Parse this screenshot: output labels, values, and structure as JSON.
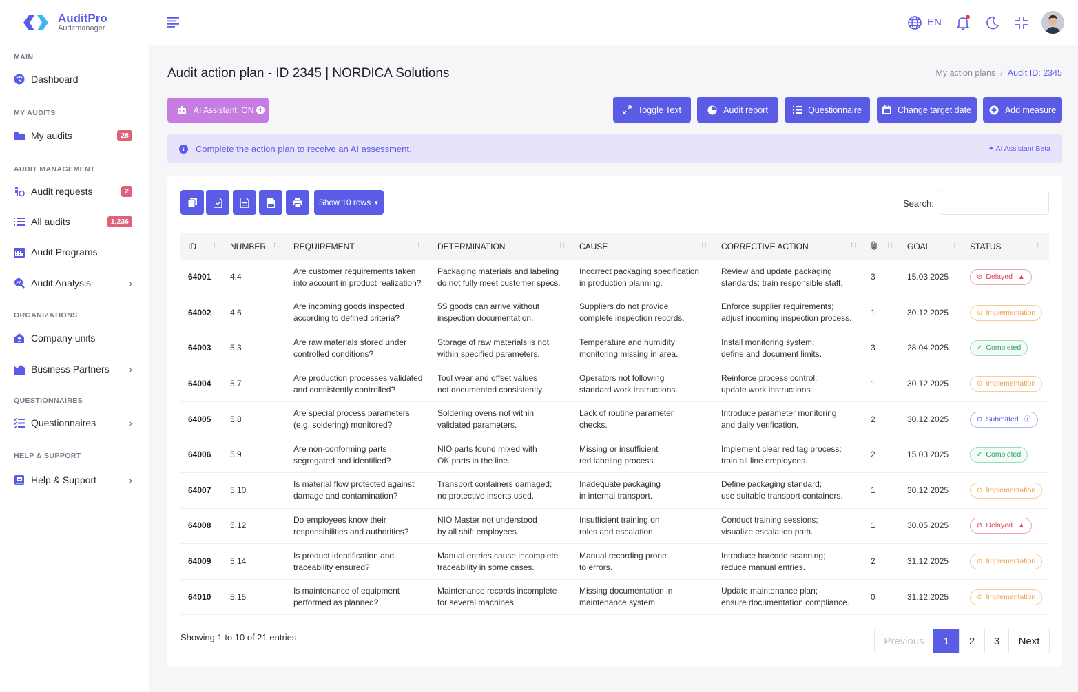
{
  "app": {
    "name": "AuditPro",
    "subtitle": "Auditmanager",
    "brand_color": "#5b5ce6"
  },
  "sidebar": {
    "sections": [
      {
        "title": "MAIN"
      },
      {
        "title": "MY AUDITS"
      },
      {
        "title": "AUDIT MANAGEMENT"
      },
      {
        "title": "ORGANIZATIONS"
      },
      {
        "title": "QUESTIONNAIRES"
      },
      {
        "title": "HELP & SUPPORT"
      }
    ],
    "items": [
      {
        "label": "Dashboard",
        "icon": "dashboard-icon"
      },
      {
        "label": "My audits",
        "icon": "folder-icon",
        "badge": "28"
      },
      {
        "label": "Audit requests",
        "icon": "request-icon",
        "badge": "2"
      },
      {
        "label": "All audits",
        "icon": "list-icon",
        "badge": "1,236"
      },
      {
        "label": "Audit Programs",
        "icon": "calendar-icon"
      },
      {
        "label": "Audit Analysis",
        "icon": "analysis-icon",
        "chevron": true
      },
      {
        "label": "Company units",
        "icon": "company-icon"
      },
      {
        "label": "Business Partners",
        "icon": "chart-icon",
        "chevron": true
      },
      {
        "label": "Questionnaires",
        "icon": "checklist-icon",
        "chevron": true
      },
      {
        "label": "Help & Support",
        "icon": "help-icon",
        "chevron": true
      }
    ]
  },
  "topbar": {
    "language": "EN"
  },
  "page": {
    "title": "Audit action plan - ID 2345 | NORDICA Solutions",
    "breadcrumb": [
      "My action plans",
      "Audit ID: 2345"
    ]
  },
  "toolbar": {
    "ai_assistant": "AI Assistant: ON",
    "buttons": [
      "Toggle Text",
      "Audit report",
      "Questionnaire",
      "Change target date",
      "Add measure"
    ]
  },
  "alert": {
    "text": "Complete the action plan to receive an AI assessment.",
    "right": "AI Assistant Beta"
  },
  "table": {
    "show_rows": "Show 10 rows",
    "search_label": "Search:",
    "columns": [
      "ID",
      "NUMBER",
      "REQUIREMENT",
      "DETERMINATION",
      "CAUSE",
      "CORRECTIVE ACTION",
      "",
      "GOAL",
      "STATUS"
    ],
    "rows": [
      {
        "id": "64001",
        "number": "4.4",
        "req1": "Are customer requirements taken",
        "req2": "into account in product realization?",
        "det1": "Packaging materials and labeling",
        "det2": "do not fully meet customer specs.",
        "cause1": "Incorrect packaging specification",
        "cause2": "in production planning.",
        "act1": "Review and update packaging",
        "act2": "standards; train responsible staff.",
        "att": "3",
        "goal": "15.03.2025",
        "status": "Delayed",
        "kind": "delayed"
      },
      {
        "id": "64002",
        "number": "4.6",
        "req1": "Are incoming goods inspected",
        "req2": "according to defined criteria?",
        "det1": "5S goods can arrive without",
        "det2": "inspection documentation.",
        "cause1": "Suppliers do not provide",
        "cause2": "complete inspection records.",
        "act1": "Enforce supplier requirements;",
        "act2": "adjust incoming inspection process.",
        "att": "1",
        "goal": "30.12.2025",
        "status": "Implementation",
        "kind": "impl"
      },
      {
        "id": "64003",
        "number": "5.3",
        "req1": "Are raw materials stored under",
        "req2": "controlled conditions?",
        "det1": "Storage of raw materials is not",
        "det2": "within specified parameters.",
        "cause1": "Temperature and humidity",
        "cause2": "monitoring missing in area.",
        "act1": "Install monitoring system;",
        "act2": "define and document limits.",
        "att": "3",
        "goal": "28.04.2025",
        "status": "Completed",
        "kind": "comp"
      },
      {
        "id": "64004",
        "number": "5.7",
        "req1": "Are production processes validated",
        "req2": "and consistently controlled?",
        "det1": "Tool wear and offset values",
        "det2": "not documented consistently.",
        "cause1": "Operators not following",
        "cause2": "standard work instructions.",
        "act1": "Reinforce process control;",
        "act2": "update work instructions.",
        "att": "1",
        "goal": "30.12.2025",
        "status": "Implementation",
        "kind": "impl"
      },
      {
        "id": "64005",
        "number": "5.8",
        "req1": "Are special process parameters",
        "req2": "(e.g. soldering) monitored?",
        "det1": "Soldering ovens not within",
        "det2": "validated parameters.",
        "cause1": "Lack of routine parameter",
        "cause2": "checks.",
        "act1": "Introduce parameter monitoring",
        "act2": "and daily verification.",
        "att": "2",
        "goal": "30.12.2025",
        "status": "Submitted",
        "kind": "sub"
      },
      {
        "id": "64006",
        "number": "5.9",
        "req1": "Are non-conforming parts",
        "req2": "segregated and identified?",
        "det1": "NIO parts found mixed with",
        "det2": "OK parts in the line.",
        "cause1": "Missing or insufficient",
        "cause2": "red labeling process.",
        "act1": "Implement clear red tag process;",
        "act2": "train all line employees.",
        "att": "2",
        "goal": "15.03.2025",
        "status": "Completed",
        "kind": "comp"
      },
      {
        "id": "64007",
        "number": "5.10",
        "req1": "Is material flow protected against",
        "req2": "damage and contamination?",
        "det1": "Transport containers damaged;",
        "det2": "no protective inserts used.",
        "cause1": "Inadequate packaging",
        "cause2": "in internal transport.",
        "act1": "Define packaging standard;",
        "act2": "use suitable transport containers.",
        "att": "1",
        "goal": "30.12.2025",
        "status": "Implementation",
        "kind": "impl"
      },
      {
        "id": "64008",
        "number": "5.12",
        "req1": "Do employees know their",
        "req2": "responsibilities and authorities?",
        "det1": "NIO Master not understood",
        "det2": "by all shift employees.",
        "cause1": "Insufficient training on",
        "cause2": "roles and escalation.",
        "act1": "Conduct training sessions;",
        "act2": "visualize escalation path.",
        "att": "1",
        "goal": "30.05.2025",
        "status": "Delayed",
        "kind": "delayed"
      },
      {
        "id": "64009",
        "number": "5.14",
        "req1": "Is product identification and",
        "req2": "traceability ensured?",
        "det1": "Manual entries cause incomplete",
        "det2": "traceability in some cases.",
        "cause1": "Manual recording prone",
        "cause2": "to errors.",
        "act1": "Introduce barcode scanning;",
        "act2": "reduce manual entries.",
        "att": "2",
        "goal": "31.12.2025",
        "status": "Implementation",
        "kind": "impl"
      },
      {
        "id": "64010",
        "number": "5.15",
        "req1": "Is maintenance of equipment",
        "req2": "performed as planned?",
        "det1": "Maintenance records incomplete",
        "det2": "for several machines.",
        "cause1": "Missing documentation in",
        "cause2": "maintenance system.",
        "act1": "Update maintenance plan;",
        "act2": "ensure documentation compliance.",
        "att": "0",
        "goal": "31.12.2025",
        "status": "Implementation",
        "kind": "impl"
      }
    ],
    "info": "Showing 1 to 10 of 21 entries",
    "pagination": [
      "Previous",
      "1",
      "2",
      "3",
      "Next"
    ]
  }
}
